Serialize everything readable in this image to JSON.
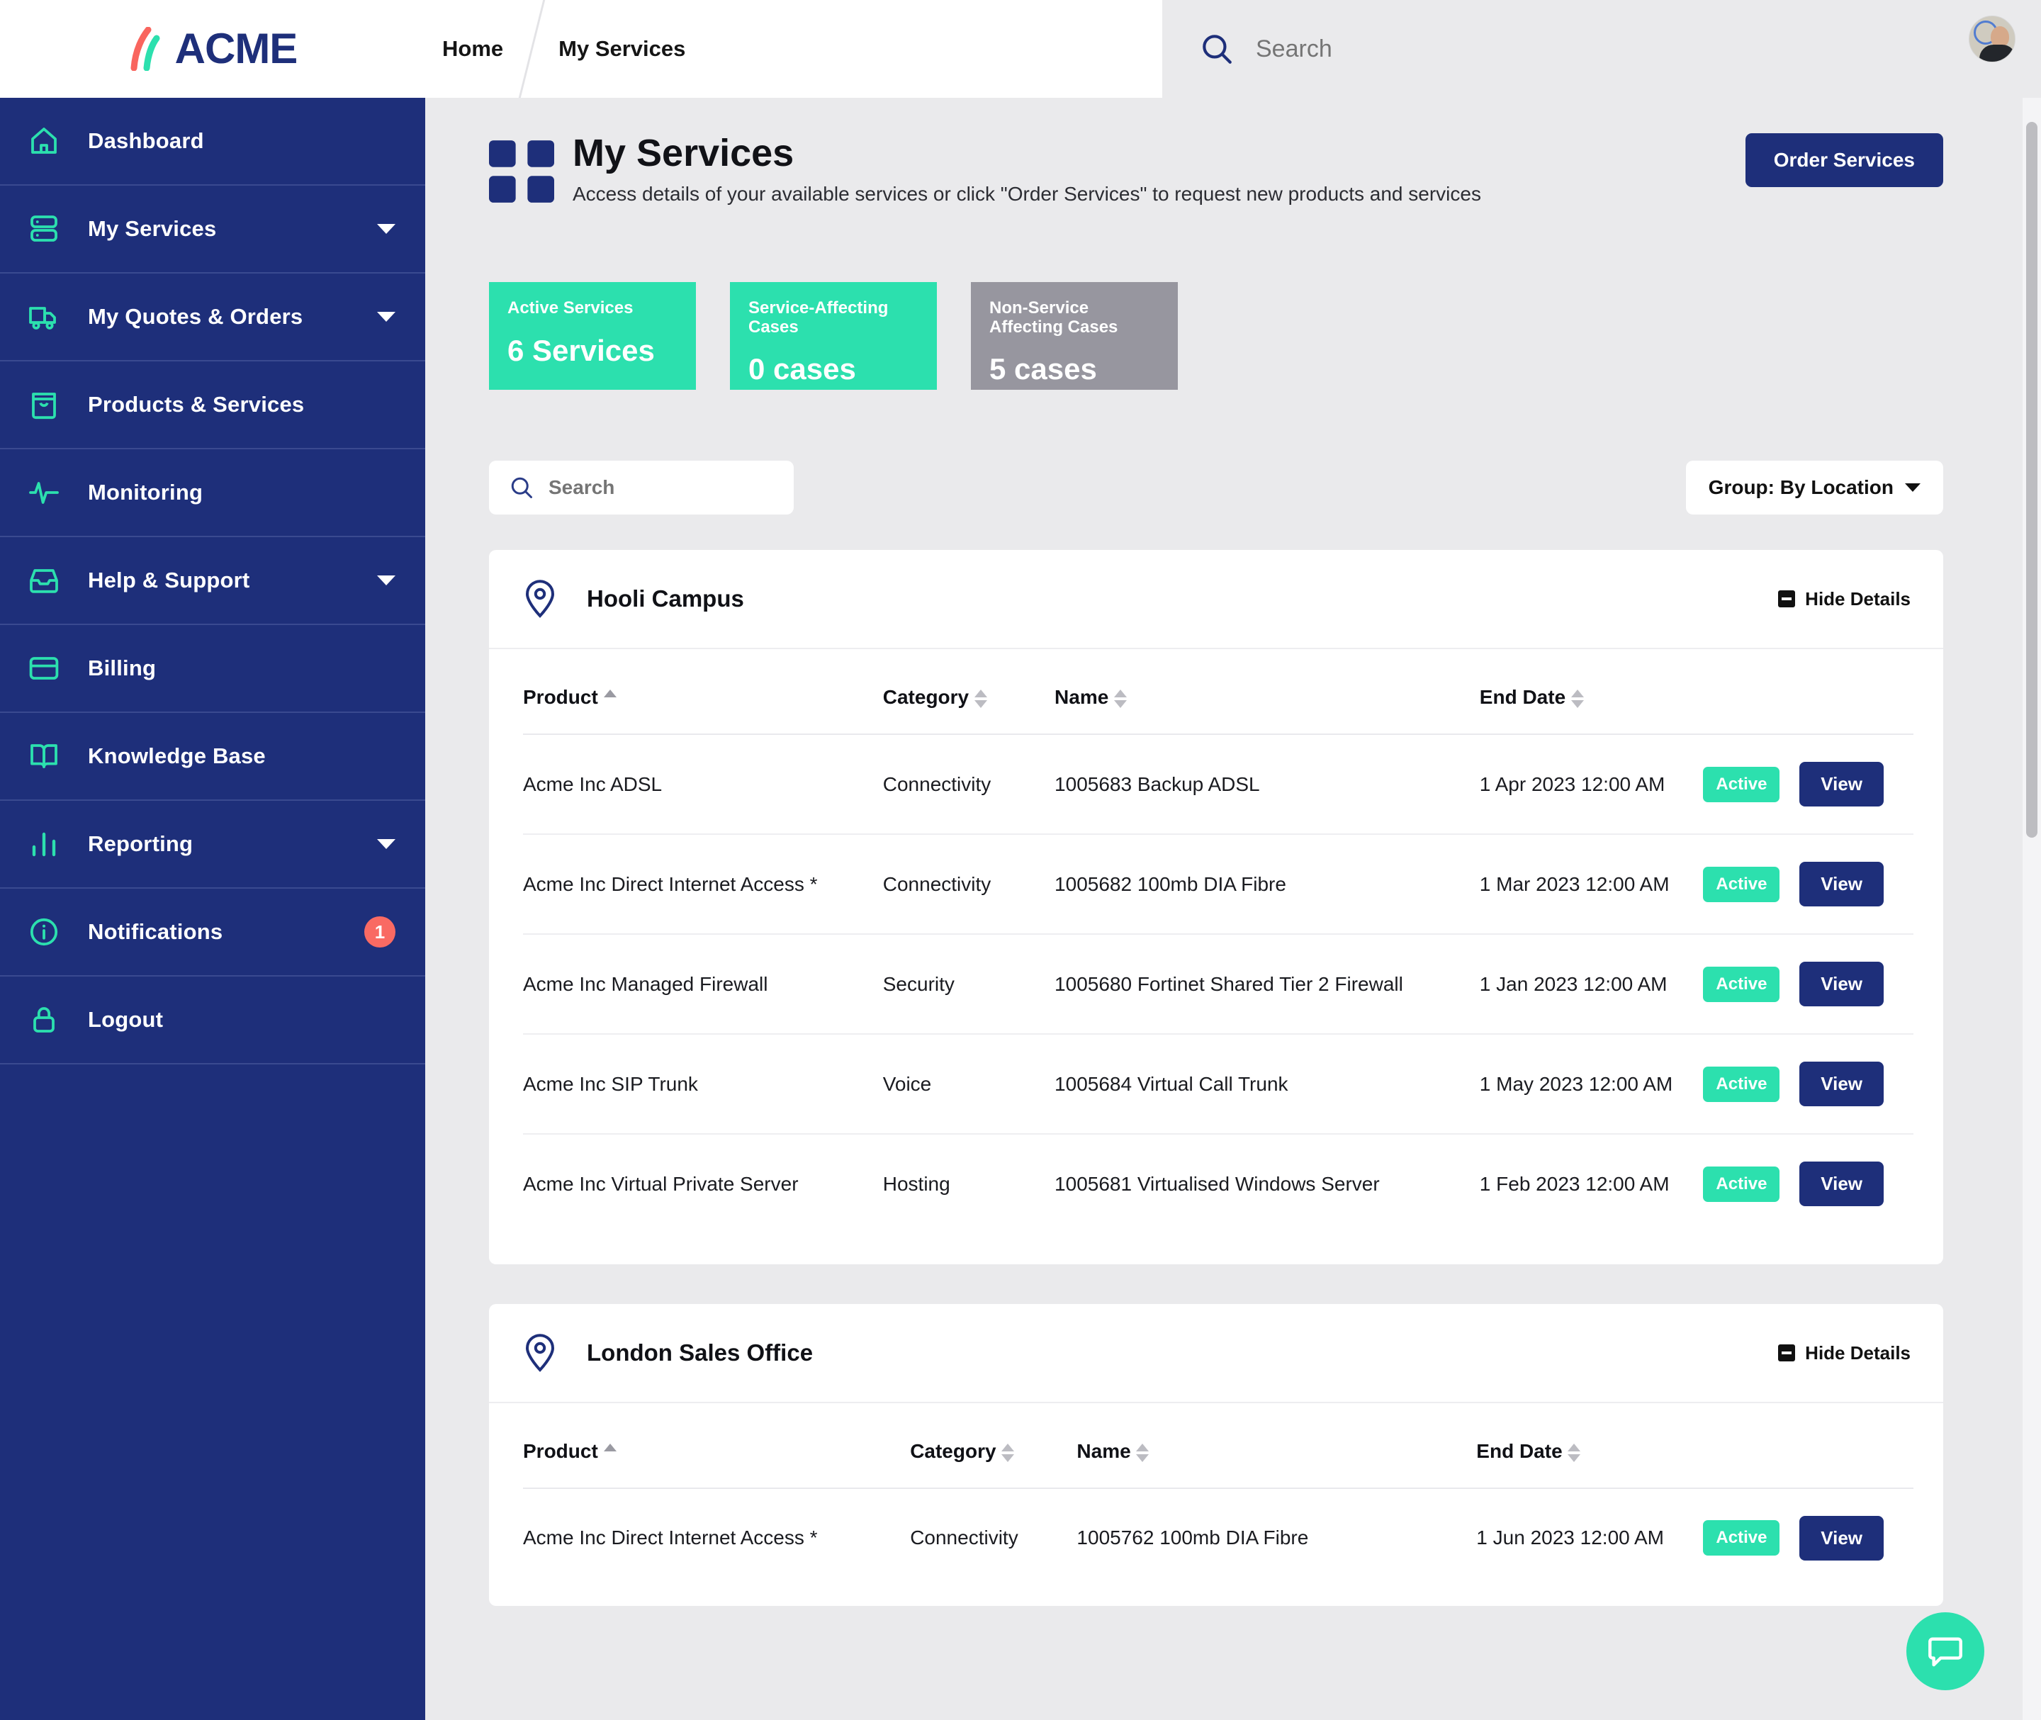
{
  "brand": {
    "name": "ACME",
    "navy": "#1e2f7a",
    "teal": "#2ce0ae",
    "coral": "#f96a63",
    "gray": "#97969f"
  },
  "topbar": {
    "breadcrumbs": [
      {
        "label": "Home"
      },
      {
        "label": "My Services"
      }
    ],
    "search": {
      "placeholder": "Search",
      "value": ""
    },
    "avatar_name": "user-avatar"
  },
  "sidebar": {
    "items": [
      {
        "label": "Dashboard",
        "icon": "home-icon",
        "caret": false,
        "badge": null
      },
      {
        "label": "My Services",
        "icon": "server-icon",
        "caret": true,
        "badge": null
      },
      {
        "label": "My Quotes & Orders",
        "icon": "truck-icon",
        "caret": true,
        "badge": null
      },
      {
        "label": "Products & Services",
        "icon": "bag-icon",
        "caret": false,
        "badge": null
      },
      {
        "label": "Monitoring",
        "icon": "pulse-icon",
        "caret": false,
        "badge": null
      },
      {
        "label": "Help & Support",
        "icon": "inbox-icon",
        "caret": true,
        "badge": null
      },
      {
        "label": "Billing",
        "icon": "card-icon",
        "caret": false,
        "badge": null
      },
      {
        "label": "Knowledge Base",
        "icon": "book-icon",
        "caret": false,
        "badge": null
      },
      {
        "label": "Reporting",
        "icon": "bar-chart-icon",
        "caret": true,
        "badge": null
      },
      {
        "label": "Notifications",
        "icon": "info-icon",
        "caret": false,
        "badge": "1"
      },
      {
        "label": "Logout",
        "icon": "lock-icon",
        "caret": false,
        "badge": null
      }
    ]
  },
  "page": {
    "icon": "grid-icon",
    "title": "My Services",
    "subtitle": "Access details of your available services or click \"Order Services\" to request new products and services",
    "order_button": "Order Services"
  },
  "stats": [
    {
      "label": "Active Services",
      "value": "6 Services",
      "color": "teal"
    },
    {
      "label": "Service-Affecting Cases",
      "value": "0 cases",
      "color": "teal"
    },
    {
      "label": "Non-Service Affecting Cases",
      "value": "5 cases",
      "color": "gray"
    }
  ],
  "filters": {
    "search_placeholder": "Search",
    "search_value": "",
    "group_label": "Group: By Location"
  },
  "table_columns": [
    "Product",
    "Category",
    "Name",
    "End Date"
  ],
  "sort": {
    "column": "Product",
    "direction": "asc"
  },
  "hide_details_label": "Hide Details",
  "locations": [
    {
      "name": "Hooli Campus",
      "rows": [
        {
          "product": "Acme Inc ADSL",
          "category": "Connectivity",
          "name": "1005683 Backup ADSL",
          "end_date": "1 Apr 2023 12:00 AM",
          "status": "Active",
          "action": "View"
        },
        {
          "product": "Acme Inc Direct Internet Access *",
          "category": "Connectivity",
          "name": "1005682 100mb DIA Fibre",
          "end_date": "1 Mar 2023 12:00 AM",
          "status": "Active",
          "action": "View"
        },
        {
          "product": "Acme Inc Managed Firewall",
          "category": "Security",
          "name": "1005680 Fortinet Shared Tier 2 Firewall",
          "end_date": "1 Jan 2023 12:00 AM",
          "status": "Active",
          "action": "View"
        },
        {
          "product": "Acme Inc SIP Trunk",
          "category": "Voice",
          "name": "1005684 Virtual Call Trunk",
          "end_date": "1 May 2023 12:00 AM",
          "status": "Active",
          "action": "View"
        },
        {
          "product": "Acme Inc Virtual Private Server",
          "category": "Hosting",
          "name": "1005681 Virtualised Windows Server",
          "end_date": "1 Feb 2023 12:00 AM",
          "status": "Active",
          "action": "View"
        }
      ]
    },
    {
      "name": "London Sales Office",
      "rows": [
        {
          "product": "Acme Inc Direct Internet Access *",
          "category": "Connectivity",
          "name": "1005762 100mb DIA Fibre",
          "end_date": "1 Jun 2023 12:00 AM",
          "status": "Active",
          "action": "View"
        }
      ]
    }
  ],
  "chat": {
    "icon": "chat-bubble-icon"
  }
}
